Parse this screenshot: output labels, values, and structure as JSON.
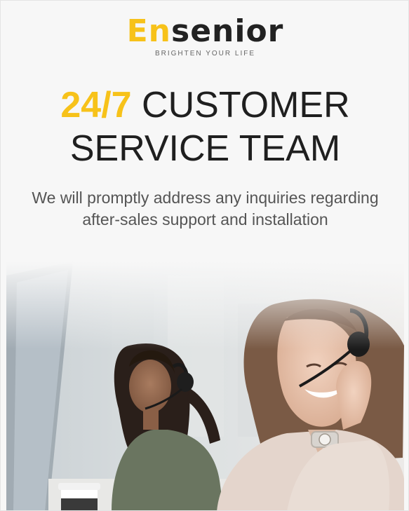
{
  "brand": {
    "logo_en": "En",
    "logo_rest": "senior",
    "tagline": "BRIGHTEN YOUR LIFE",
    "accent_color": "#f7c21a"
  },
  "headline": {
    "accent": "24/7",
    "line1_rest": " CUSTOMER",
    "line2": "SERVICE TEAM"
  },
  "subtext": "We will promptly address any inquiries regarding after-sales support and installation",
  "photo": {
    "subject": "two customer service agents wearing headsets"
  }
}
